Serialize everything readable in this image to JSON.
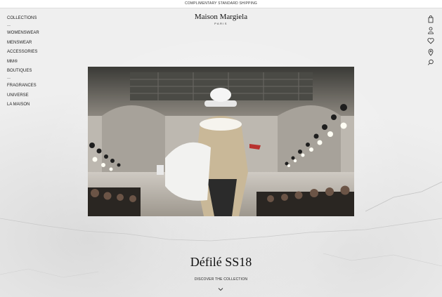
{
  "topbar": {
    "text": "COMPLIMENTARY STANDARD SHIPPING"
  },
  "brand": {
    "name": "Maison Margiela",
    "city": "PARIS"
  },
  "nav": {
    "items": [
      {
        "label": "COLLECTIONS"
      },
      {
        "label": "WOMENSWEAR"
      },
      {
        "label": "MENSWEAR"
      },
      {
        "label": "ACCESSORIES"
      },
      {
        "label": "MM⑥"
      },
      {
        "label": "BOUTIQUES"
      },
      {
        "label": "FRAGRANCES"
      },
      {
        "label": "UNIVERSE"
      },
      {
        "label": "LA MAISON"
      }
    ],
    "separator": "—"
  },
  "header_icons": [
    "bag-icon",
    "account-icon",
    "wishlist-heart-icon",
    "store-locator-pin-icon",
    "search-icon"
  ],
  "hero": {
    "title": "Défilé SS18",
    "cta": "DISCOVER THE COLLECTION"
  }
}
